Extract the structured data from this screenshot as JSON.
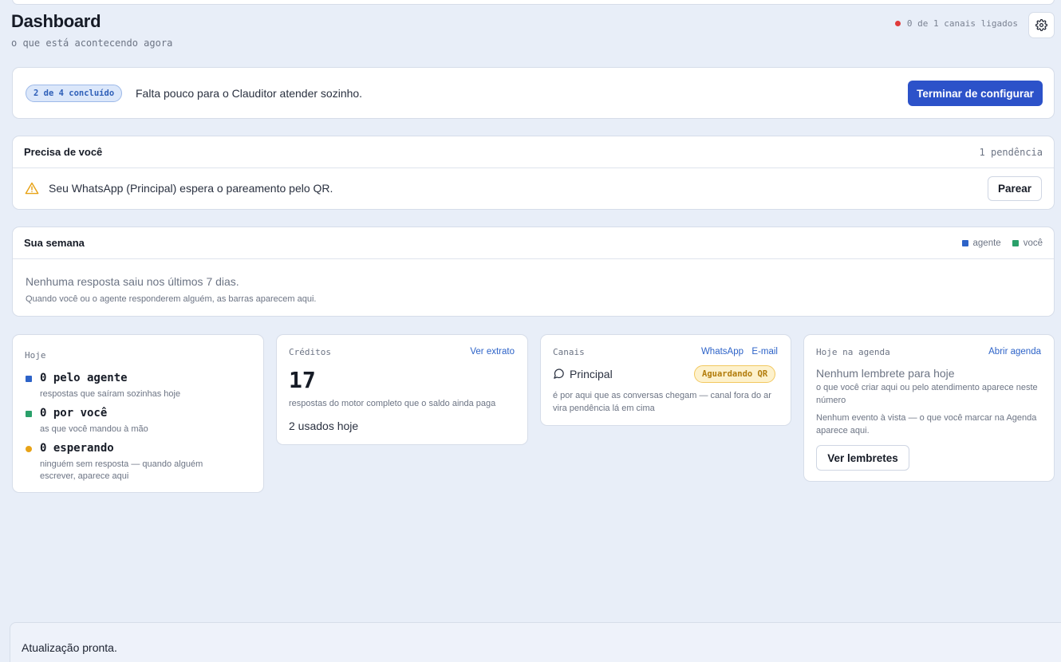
{
  "header": {
    "title": "Dashboard",
    "subtitle": "o que está acontecendo agora",
    "channels_status": "0 de 1 canais ligados",
    "status_color": "#e03b3b"
  },
  "setup": {
    "badge": "2 de 4 concluído",
    "message": "Falta pouco para o Clauditor atender sozinho.",
    "button_label": "Terminar de configurar",
    "accent": "#2c52c9"
  },
  "needs_you": {
    "title": "Precisa de você",
    "count": "1 pendência",
    "alert_icon": "warning-icon",
    "alert_text": "Seu WhatsApp (Principal) espera o pareamento pelo QR.",
    "button_label": "Parear"
  },
  "week": {
    "title": "Sua semana",
    "legend": [
      {
        "label": "agente",
        "color": "#2d63c8"
      },
      {
        "label": "você",
        "color": "#2aa06a"
      }
    ],
    "empty_text": "Nenhuma resposta saiu nos últimos 7 dias.",
    "hint": "Quando você ou o agente responderem alguém, as barras aparecem aqui."
  },
  "today": {
    "label": "Hoje",
    "items": [
      {
        "title": "0 pelo agente",
        "desc": "respostas que saíram sozinhas hoje",
        "color": "#2d63c8"
      },
      {
        "title": "0 por você",
        "desc": "as que você mandou à mão",
        "color": "#2aa06a"
      },
      {
        "title": "0 esperando",
        "desc": "ninguém sem resposta — quando alguém escrever, aparece aqui",
        "color": "#e8a317"
      }
    ]
  },
  "credits": {
    "label": "Créditos",
    "link": "Ver extrato",
    "value": "17",
    "desc": "respostas do motor completo que o saldo ainda paga",
    "used": "2 usados hoje"
  },
  "channels": {
    "label": "Canais",
    "links": [
      "WhatsApp",
      "E-mail"
    ],
    "channel_name": "Principal",
    "channel_icon": "chat-bubble-icon",
    "status_badge": "Aguardando QR",
    "desc": "é por aqui que as conversas chegam — canal fora do ar vira pendência lá em cima"
  },
  "agenda": {
    "label": "Hoje na agenda",
    "link": "Abrir agenda",
    "empty": "Nenhum lembrete para hoje",
    "sub": "o que você criar aqui ou pelo atendimento aparece neste número",
    "events": "Nenhum evento à vista — o que você marcar na Agenda aparece aqui.",
    "button_label": "Ver lembretes"
  },
  "toast": {
    "message": "Atualização pronta."
  }
}
